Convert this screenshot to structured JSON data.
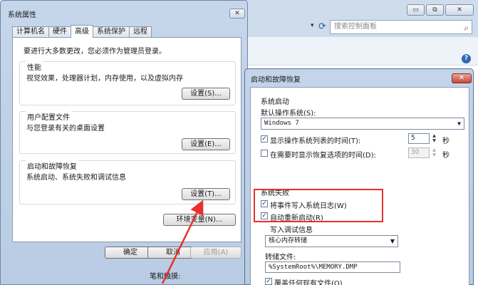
{
  "background_window": {
    "caption_minimize": "▭",
    "caption_restore": "⧉",
    "caption_close": "✕",
    "search_placeholder": "搜索控制面板",
    "search_icon": "magnifier-icon",
    "refresh_icon": "refresh-icon",
    "help_label": "?"
  },
  "system_properties": {
    "title": "系统属性",
    "close_label": "✕",
    "tabs": [
      "计算机名",
      "硬件",
      "高级",
      "系统保护",
      "远程"
    ],
    "active_tab": "高级",
    "admin_note": "要进行大多数更改，您必须作为管理员登录。",
    "groups": {
      "performance": {
        "title": "性能",
        "desc": "视觉效果，处理器计划，内存使用，以及虚拟内存",
        "button": "设置(S)..."
      },
      "profiles": {
        "title": "用户配置文件",
        "desc": "与您登录有关的桌面设置",
        "button": "设置(E)..."
      },
      "startup": {
        "title": "启动和故障恢复",
        "desc": "系统启动、系统失败和调试信息",
        "button": "设置(T)..."
      }
    },
    "env_button": "环境变量(N)...",
    "ok": "确定",
    "cancel": "取消",
    "apply": "应用(A)",
    "bottom_partial_text": "笔和触摸:"
  },
  "startup_recovery": {
    "title": "启动和故障恢复",
    "close_label": "✕",
    "system_startup_heading": "系统启动",
    "default_os_label": "默认操作系统(S):",
    "default_os_value": "Windows 7",
    "show_list_label": "显示操作系统列表的时间(T):",
    "show_list_checked": true,
    "show_list_value": "5",
    "show_list_unit": "秒",
    "show_recovery_label": "在需要时显示恢复选项的时间(D):",
    "show_recovery_checked": false,
    "show_recovery_value": "30",
    "show_recovery_unit": "秒",
    "system_failure_heading": "系统失败",
    "write_event_label": "将事件写入系统日志(W)",
    "write_event_checked": true,
    "auto_restart_label": "自动重新启动(R)",
    "auto_restart_checked": true,
    "debug_info_heading": "写入调试信息",
    "debug_type_value": "核心内存转储",
    "dump_file_label": "转储文件:",
    "dump_file_value": "%SystemRoot%\\MEMORY.DMP",
    "overwrite_label": "覆盖任何现有文件(O)",
    "overwrite_checked": true
  },
  "colors": {
    "highlight": "#e8302c",
    "arrow": "#e8302c"
  }
}
